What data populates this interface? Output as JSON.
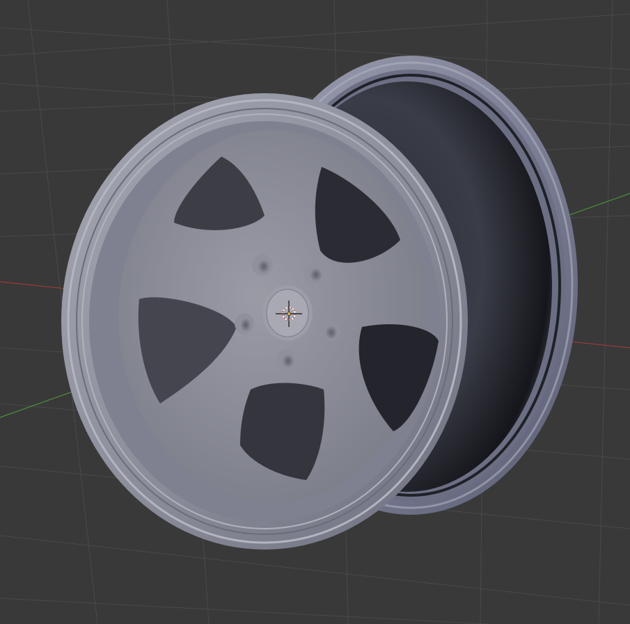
{
  "viewport": {
    "background_color": "#393939",
    "grid_color": "#4a4a4a",
    "x_axis_color": "#9c3a3a",
    "y_axis_color": "#4f8f3b"
  },
  "object": {
    "type": "wheel-rim",
    "spoke_count": 5,
    "lug_count": 5,
    "material_color": "#8a8c97"
  },
  "cursor_3d": {
    "icon": "3d-cursor-icon"
  }
}
